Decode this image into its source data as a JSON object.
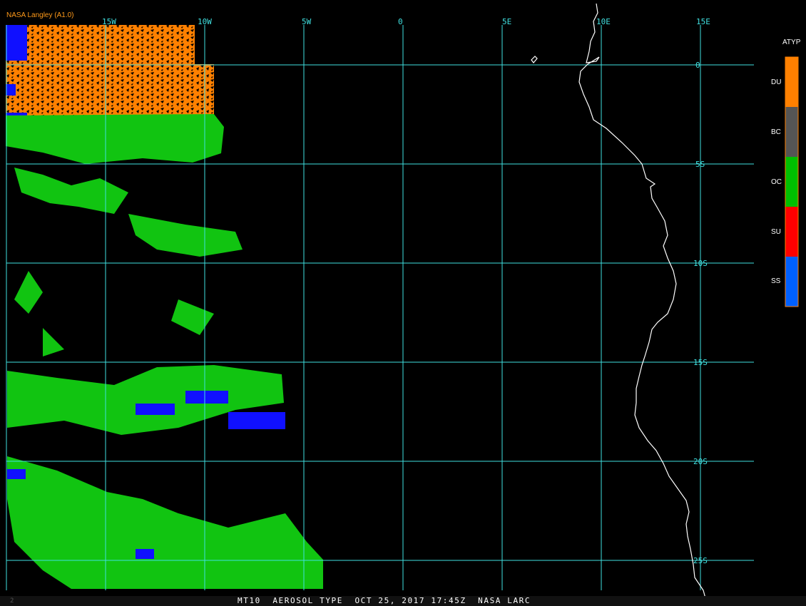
{
  "header": {
    "source": "NASA Langley (A1.0)"
  },
  "footer": {
    "caption": "MT10  AEROSOL TYPE  OCT 25, 2017 17:45Z  NASA LARC",
    "frame": "2"
  },
  "map": {
    "longitude_labels": [
      "15W",
      "10W",
      "5W",
      "0",
      "5E",
      "10E",
      "15E"
    ],
    "latitude_labels": [
      "0",
      "5S",
      "10S",
      "15S",
      "20S",
      "25S"
    ],
    "grid_color": "#40e0e0",
    "coast_color": "#ffffff"
  },
  "legend": {
    "title": "ATYP",
    "items": [
      {
        "code": "DU",
        "color": "#ff8000"
      },
      {
        "code": "BC",
        "color": "#555555"
      },
      {
        "code": "OC",
        "color": "#00c000"
      },
      {
        "code": "SU",
        "color": "#ff0000"
      },
      {
        "code": "SS",
        "color": "#0060ff"
      }
    ]
  },
  "colors": {
    "dust": "#ff8000",
    "organic": "#11c411",
    "sea_salt": "#1010ff"
  }
}
